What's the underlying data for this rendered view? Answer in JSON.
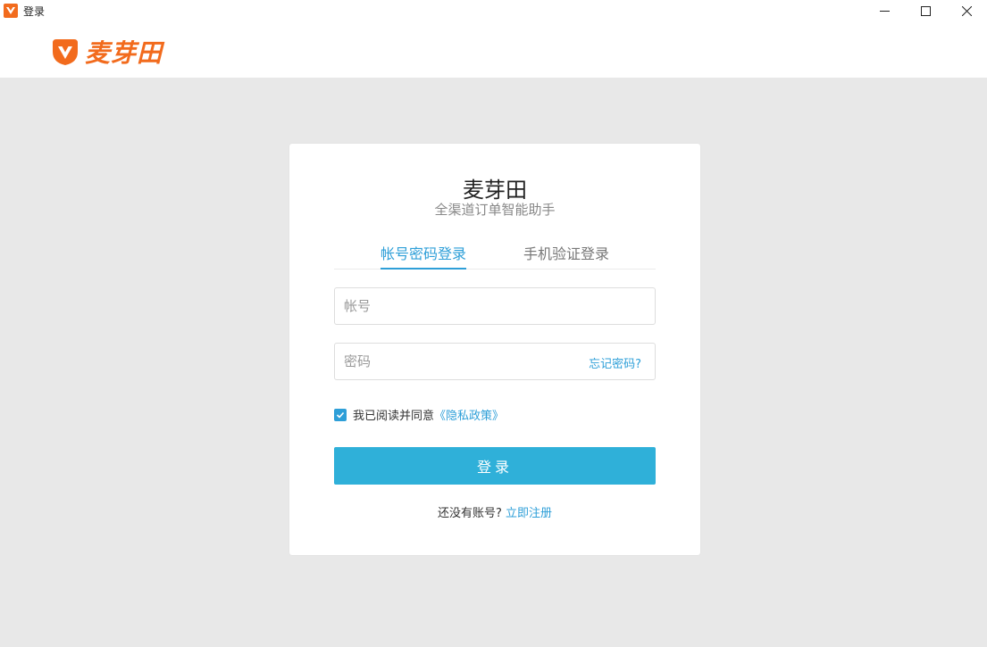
{
  "window": {
    "title": "登录",
    "controls": {
      "minimize": "—",
      "maximize": "☐",
      "close": "✕"
    }
  },
  "brand": {
    "name": "麦芽田",
    "accent_color": "#f26b1d"
  },
  "card": {
    "title": "麦芽田",
    "subtitle": "全渠道订单智能助手"
  },
  "tabs": [
    {
      "label": "帐号密码登录",
      "active": true
    },
    {
      "label": "手机验证登录",
      "active": false
    }
  ],
  "form": {
    "account_placeholder": "帐号",
    "account_value": "",
    "password_placeholder": "密码",
    "password_value": "",
    "forgot_label": "忘记密码?",
    "agree_text": "我已阅读并同意",
    "policy_link": "《隐私政策》",
    "agree_checked": true,
    "login_label": "登录"
  },
  "register": {
    "prompt": "还没有账号?",
    "link": "立即注册"
  },
  "colors": {
    "primary": "#2fb0d9",
    "link": "#2e9fd8",
    "background": "#e8e8e8"
  }
}
